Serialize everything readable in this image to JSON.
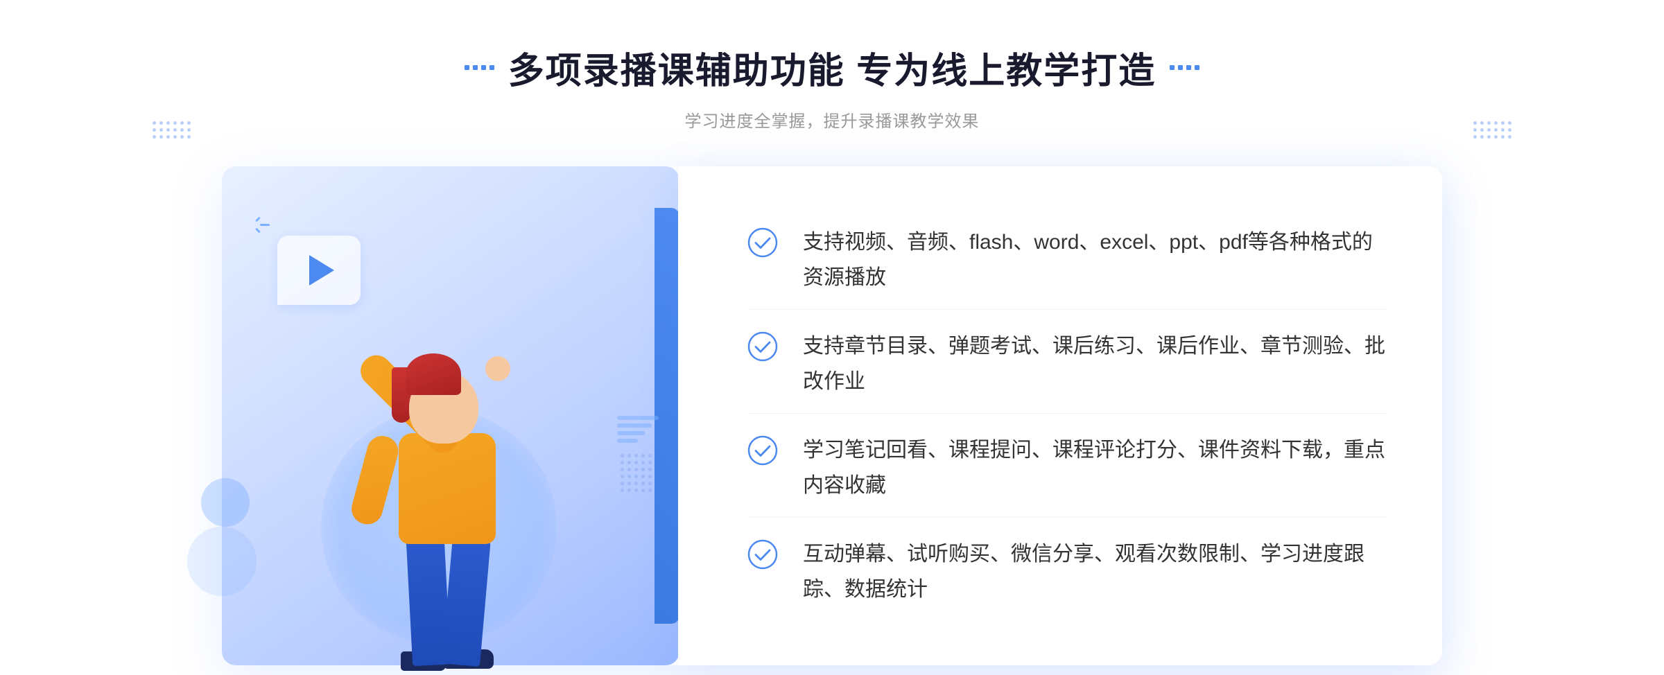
{
  "page": {
    "background": "#ffffff"
  },
  "header": {
    "title": "多项录播课辅助功能 专为线上教学打造",
    "subtitle": "学习进度全掌握，提升录播课教学效果",
    "title_dots_left": "decorative",
    "title_dots_right": "decorative"
  },
  "features": [
    {
      "id": 1,
      "text": "支持视频、音频、flash、word、excel、ppt、pdf等各种格式的资源播放"
    },
    {
      "id": 2,
      "text": "支持章节目录、弹题考试、课后练习、课后作业、章节测验、批改作业"
    },
    {
      "id": 3,
      "text": "学习笔记回看、课程提问、课程评论打分、课件资料下载，重点内容收藏"
    },
    {
      "id": 4,
      "text": "互动弹幕、试听购买、微信分享、观看次数限制、学习进度跟踪、数据统计"
    }
  ],
  "colors": {
    "primary_blue": "#4d8af0",
    "dark_blue": "#1e4bb8",
    "orange": "#f5a623",
    "text_dark": "#333333",
    "text_light": "#999999",
    "check_color": "#4d8af0"
  },
  "icons": {
    "check": "check-circle-icon",
    "play": "play-icon",
    "chevron_left": "«",
    "decorative_dots": "dots-pattern"
  }
}
